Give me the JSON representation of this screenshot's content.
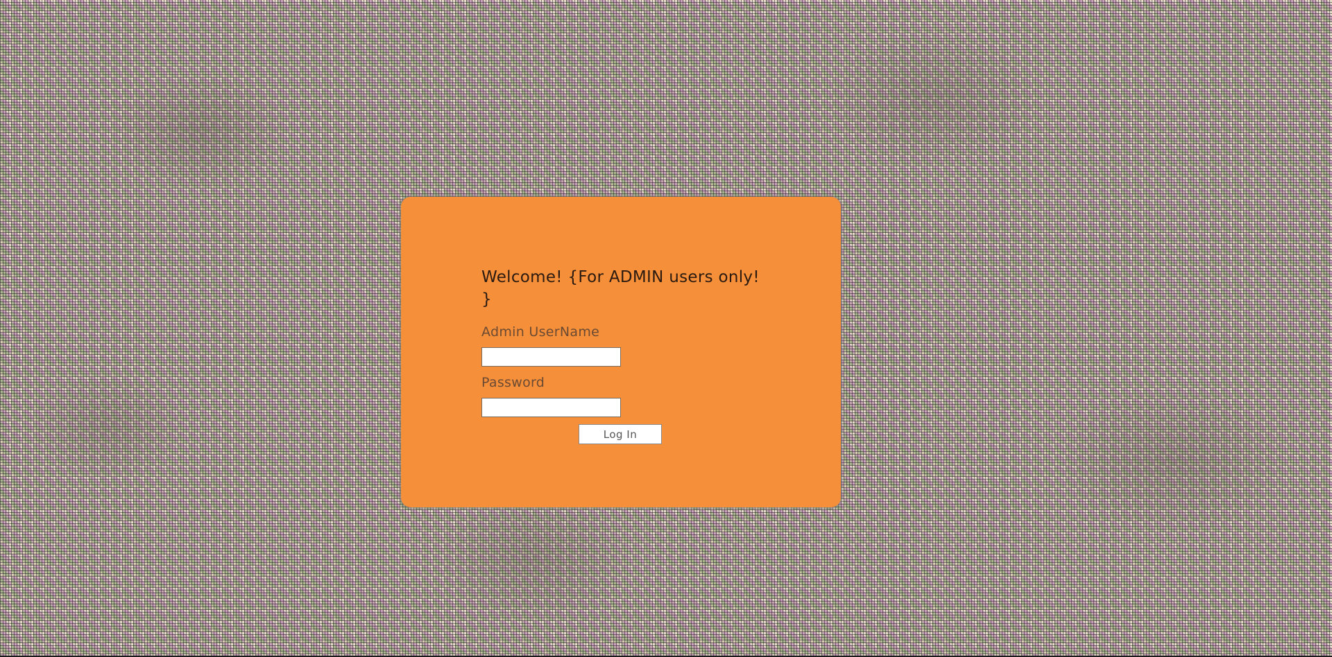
{
  "login": {
    "title": "Welcome! {For ADMIN users only! }",
    "username_label": "Admin UserName",
    "username_value": "",
    "password_label": "Password",
    "password_value": "",
    "submit_label": "Log In"
  },
  "colors": {
    "card_background": "#f68f39",
    "title_text": "#2a1a10",
    "label_text": "#6a4a33",
    "button_text": "#555555"
  }
}
